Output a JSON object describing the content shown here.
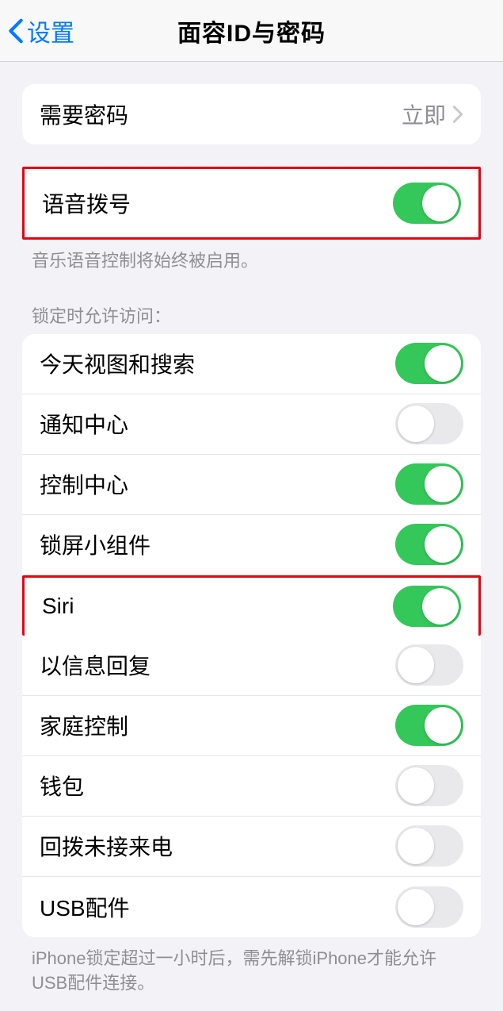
{
  "nav": {
    "back": "设置",
    "title": "面容ID与密码"
  },
  "passcode": {
    "label": "需要密码",
    "value": "立即"
  },
  "voice": {
    "label": "语音拨号",
    "on": true,
    "footer": "音乐语音控制将始终被启用。"
  },
  "lockedHeader": "锁定时允许访问：",
  "locked": [
    {
      "label": "今天视图和搜索",
      "on": true
    },
    {
      "label": "通知中心",
      "on": false
    },
    {
      "label": "控制中心",
      "on": true
    },
    {
      "label": "锁屏小组件",
      "on": true
    },
    {
      "label": "Siri",
      "on": true
    },
    {
      "label": "以信息回复",
      "on": false
    },
    {
      "label": "家庭控制",
      "on": true
    },
    {
      "label": "钱包",
      "on": false
    },
    {
      "label": "回拨未接来电",
      "on": false
    },
    {
      "label": "USB配件",
      "on": false
    }
  ],
  "lockedFooter": "iPhone锁定超过一小时后，需先解锁iPhone才能允许USB配件连接。",
  "highlightVoice": true,
  "highlightSiriIndex": 4
}
